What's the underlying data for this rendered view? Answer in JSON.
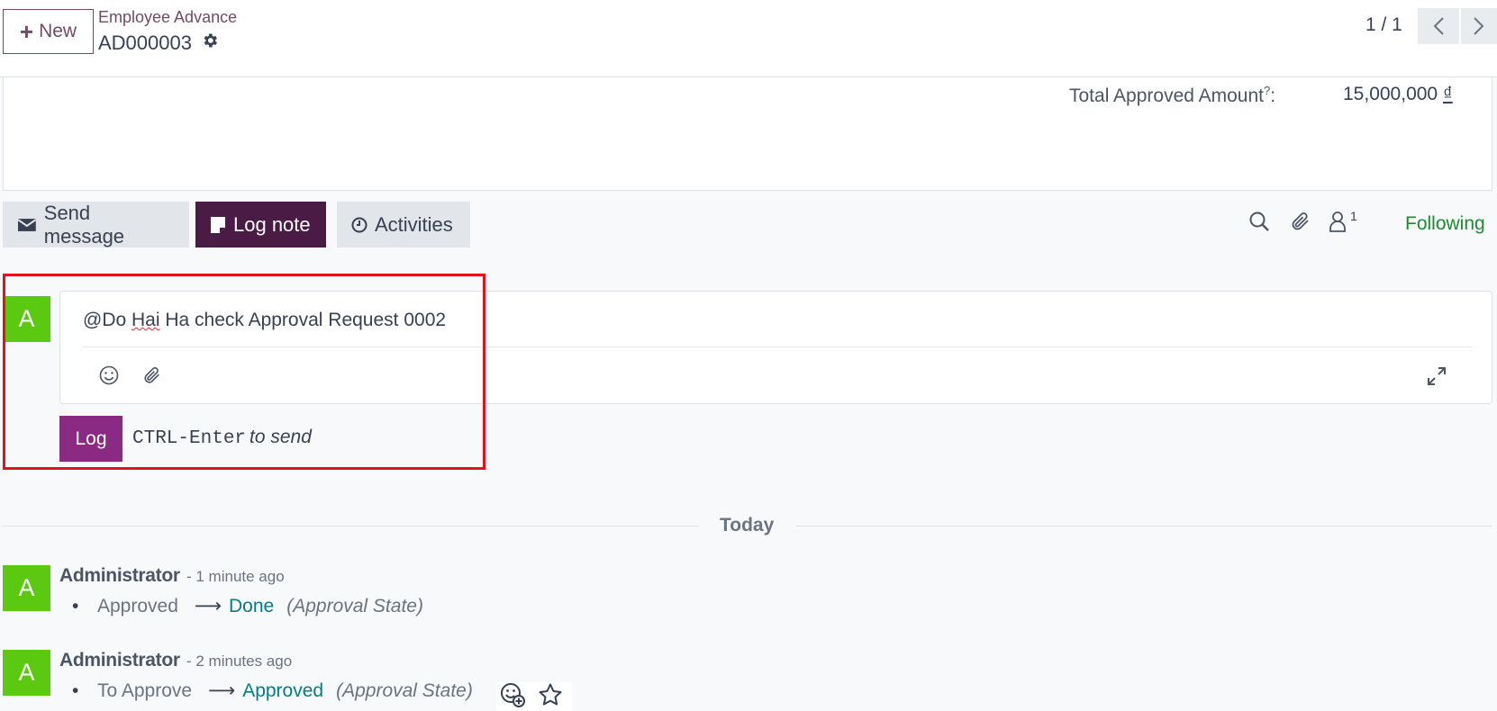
{
  "control_panel": {
    "new_label": "New",
    "breadcrumb_parent": "Employee Advance",
    "record_name": "AD000003",
    "pager_value": "1 / 1"
  },
  "form": {
    "total_label": "Total Approved Amount",
    "total_help": "?",
    "total_colon": ":",
    "total_amount": "15,000,000",
    "currency_symbol": "₫"
  },
  "chatter": {
    "send_message_label": "Send message",
    "log_note_label": "Log note",
    "activities_label": "Activities",
    "followers_count": "1",
    "following_label": "Following",
    "composer": {
      "text_before": "@Do ",
      "text_misspelled": "Hai",
      "text_after": " Ha check Approval Request 0002",
      "submit_label": "Log",
      "hint_keys": "CTRL-Enter",
      "hint_text": "to send"
    },
    "avatar_letter": "A",
    "date_separator": "Today",
    "messages": [
      {
        "author": "Administrator",
        "time": "- 1 minute ago",
        "old_value": "Approved",
        "new_value": "Done",
        "field": "(Approval State)"
      },
      {
        "author": "Administrator",
        "time": "- 2 minutes ago",
        "old_value": "To Approve",
        "new_value": "Approved",
        "field": "(Approval State)"
      }
    ]
  },
  "colors": {
    "brand": "#714b67",
    "log_note_active": "#4a1b45",
    "log_button": "#8a2a82",
    "following": "#1c8b2f",
    "new_value": "#017e84",
    "avatar": "#5ac90f",
    "highlight": "#e3121b"
  },
  "icons": [
    "plus-icon",
    "gear-icon",
    "chevron-left-icon",
    "chevron-right-icon",
    "envelope-icon",
    "sticky-note-icon",
    "clock-icon",
    "search-icon",
    "paperclip-icon",
    "user-icon",
    "smile-icon",
    "expand-icon",
    "arrow-right-icon",
    "add-reaction-icon",
    "star-icon"
  ]
}
